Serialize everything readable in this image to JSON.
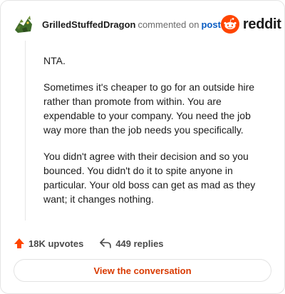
{
  "header": {
    "username": "GrilledStuffedDragon",
    "action_text": "commented on",
    "post_link": "post",
    "brand": "reddit"
  },
  "comment": {
    "paragraphs": [
      "NTA.",
      "Sometimes it's cheaper to go for an outside hire rather than promote from within. You are expendable to your company. You need the job way more than the job needs you specifically.",
      "You didn't agree with their decision and so you bounced. You didn't do it to spite anyone in particular. Your old boss can get as mad as they want; it changes nothing."
    ]
  },
  "actions": {
    "upvotes": "18K upvotes",
    "replies": "449 replies"
  },
  "cta": {
    "label": "View the conversation"
  },
  "colors": {
    "brand_orange": "#ff4500",
    "link_blue": "#0a5cc2",
    "cta_text": "#d93a00"
  }
}
